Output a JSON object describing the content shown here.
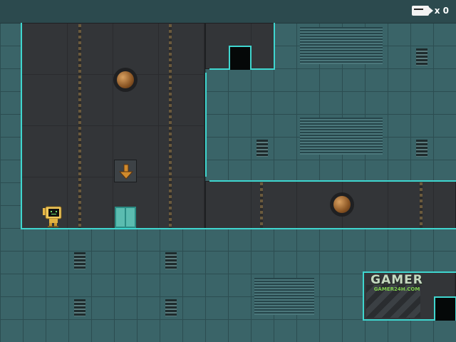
{
  "hud": {
    "item_icon": "battery-card-icon",
    "count": "x 0"
  },
  "watermark": {
    "title": "GAMER",
    "subtitle": "GAMER24H.COM"
  },
  "scene": {
    "arrow_icon": "down-arrow-icon",
    "player_icon": "robot-monitor-icon",
    "colors": {
      "edge": "#3fd6cf",
      "wall": "#3a6468",
      "room": "#333538",
      "porthole": "#b87a3c"
    }
  }
}
